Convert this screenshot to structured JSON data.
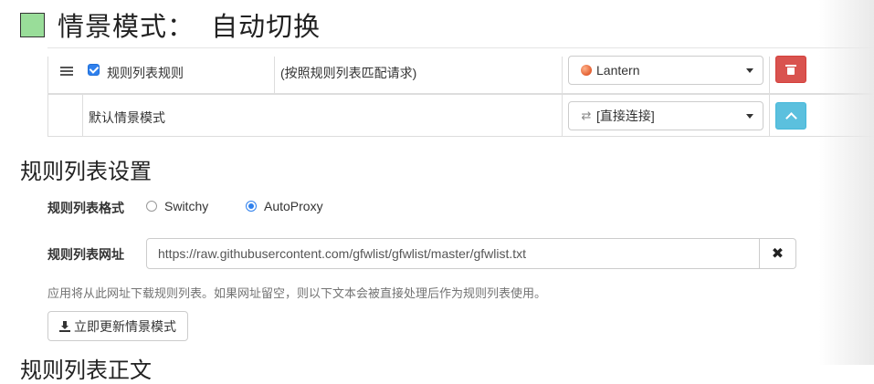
{
  "header": {
    "title": "情景模式：  自动切换",
    "swatch_color": "#99dd99"
  },
  "rules": {
    "rule_row": {
      "icon": "list-icon",
      "checked": true,
      "name": "规则列表规则",
      "description": "(按照规则列表匹配请求)",
      "profile": "Lantern",
      "profile_icon": "globe-icon",
      "action_icon": "trash-icon"
    },
    "default_row": {
      "name": "默认情景模式",
      "profile": "[直接连接]",
      "profile_icon": "direct-connect-icon",
      "action_icon": "chevron-up-icon"
    }
  },
  "rule_list_settings": {
    "title": "规则列表设置",
    "format_label": "规则列表格式",
    "format_options": [
      {
        "label": "Switchy",
        "checked": false
      },
      {
        "label": "AutoProxy",
        "checked": true
      }
    ],
    "url_label": "规则列表网址",
    "url_value": "https://raw.githubusercontent.com/gfwlist/gfwlist/master/gfwlist.txt",
    "help_text": "应用将从此网址下载规则列表。如果网址留空，则以下文本会被直接处理后作为规则列表使用。",
    "update_button": "立即更新情景模式"
  },
  "next_section_title": "规则列表正文"
}
